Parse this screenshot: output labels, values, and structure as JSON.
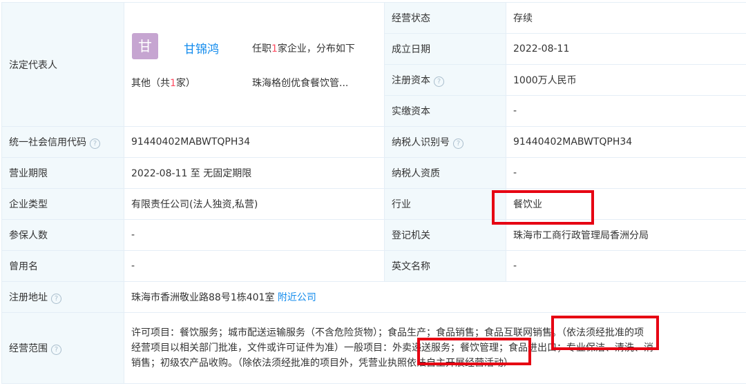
{
  "legal_rep": {
    "label": "法定代表人",
    "avatar_char": "甘",
    "name": "甘锦鸿",
    "jobs_prefix": "任职",
    "jobs_count": "1",
    "jobs_suffix": "家企业，分布如下",
    "other_prefix": "其他（共",
    "other_count": "1",
    "other_suffix": "家）",
    "company": "珠海格创优食餐饮管..."
  },
  "status": {
    "label": "经营状态",
    "value": "存续"
  },
  "founded": {
    "label": "成立日期",
    "value": "2022-08-11"
  },
  "registered_capital": {
    "label": "注册资本",
    "value": "1000万人民币"
  },
  "paid_capital": {
    "label": "实缴资本",
    "value": "-"
  },
  "credit_code": {
    "label": "统一社会信用代码",
    "value": "91440402MABWTQPH34"
  },
  "taxpayer_id": {
    "label": "纳税人识别号",
    "value": "91440402MABWTQPH34"
  },
  "business_term": {
    "label": "营业期限",
    "value": "2022-08-11 至 无固定期限"
  },
  "taxpayer_qual": {
    "label": "纳税人资质",
    "value": "-"
  },
  "company_type": {
    "label": "企业类型",
    "value": "有限责任公司(法人独资,私营)"
  },
  "industry": {
    "label": "行业",
    "value": "餐饮业"
  },
  "insured": {
    "label": "参保人数",
    "value": "-"
  },
  "authority": {
    "label": "登记机关",
    "value": "珠海市工商行政管理局香洲分局"
  },
  "former_name": {
    "label": "曾用名",
    "value": "-"
  },
  "english_name": {
    "label": "英文名称",
    "value": "-"
  },
  "address": {
    "label": "注册地址",
    "value": "珠海市香洲敬业路88号1栋401室",
    "link": "附近公司"
  },
  "scope": {
    "label": "经营范围",
    "line1": "许可项目：餐饮服务；城市配送运输服务（不含危险货物）；食品生产；食品销售；食品互联网销售。（依法须经批准的项",
    "line2": "经营项目以相关部门批准，文件或许可证件为准）一般项目：外卖递送服务；餐饮管理；食品进出口；专业保洁、清洗、消",
    "line3": "销售；初级农产品收购。（除依法须经批准的项目外，凭营业执照依法自主开展经营活动）"
  },
  "help_icon_glyph": "?",
  "colors": {
    "label_bg": "#f2f9fc",
    "border": "#e4eef6",
    "link": "#128bed",
    "highlight_number": "#fd485e",
    "annotation_box": "#e60012",
    "avatar_bg": "#c6a5d1"
  }
}
